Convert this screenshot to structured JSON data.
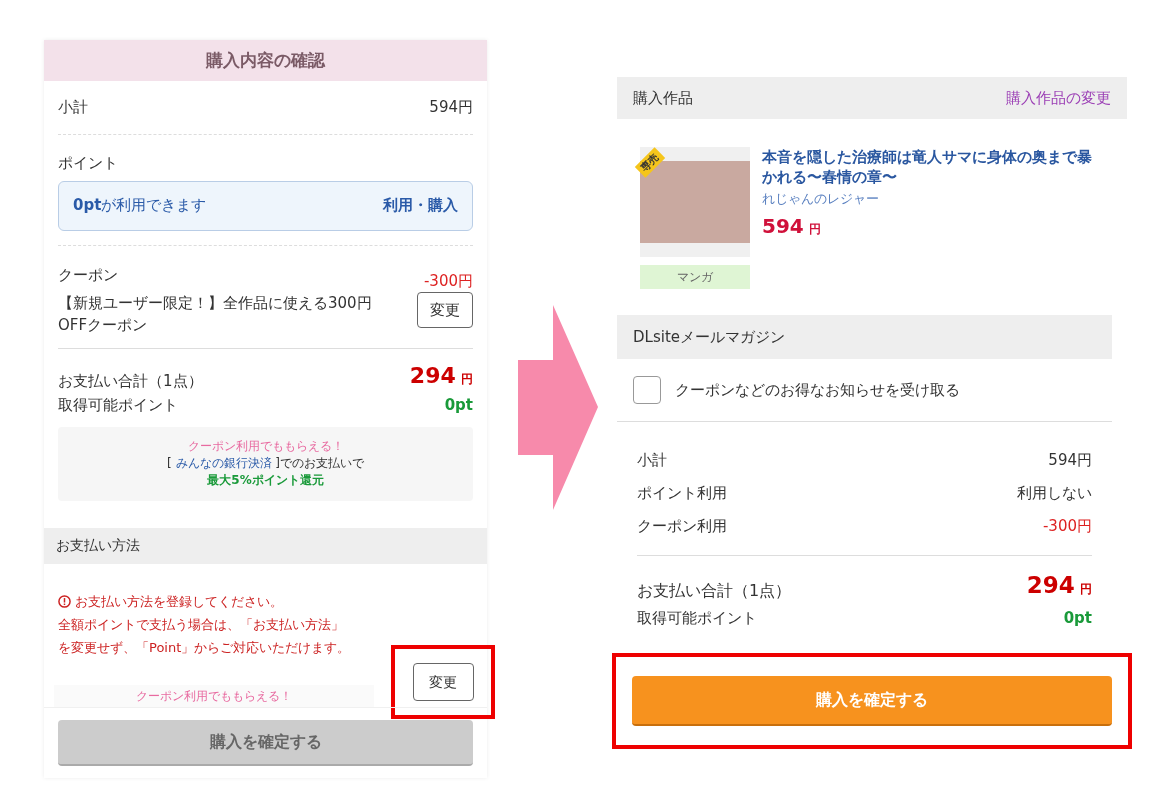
{
  "left": {
    "title": "購入内容の確認",
    "subtotal": {
      "label": "小計",
      "value": "594円"
    },
    "points": {
      "label": "ポイント",
      "amount": "0pt",
      "text": "が利用できます",
      "action": "利用・購入"
    },
    "coupon": {
      "label": "クーポン",
      "value": "-300円",
      "name": "【新規ユーザー限定！】全作品に使える300円OFFクーポン",
      "button": "変更"
    },
    "total": {
      "label": "お支払い合計（1点）",
      "amount": "294",
      "unit": "円"
    },
    "earn": {
      "label": "取得可能ポイント",
      "value": "0pt"
    },
    "promo": {
      "headline": "クーポン利用でももらえる！",
      "bracket_open": "[",
      "link": "みんなの銀行決済",
      "bracket_close": "]でのお支払いで",
      "reward": "最大5%ポイント還元"
    },
    "payment": {
      "title": "お支払い方法",
      "error_lines": [
        "お支払い方法を登録してください。",
        "全額ポイントで支払う場合は、「お支払い方法」",
        "を変更せず、「Point」からご対応いただけます。"
      ],
      "button": {
        "label": "変更",
        "highlighted": true
      }
    },
    "promo_partial": "クーポン利用でももらえる！",
    "confirm": {
      "label": "購入を確定する",
      "disabled": true
    }
  },
  "right": {
    "section": "購入作品",
    "change_link": "購入作品の変更",
    "product": {
      "badge": "専売",
      "title": "本音を隠した治療師は竜人サマに身体の奥まで暴かれる〜春情の章〜",
      "circle": "れじゃんのレジャー",
      "price": "594",
      "unit": "円",
      "category": "マンガ"
    },
    "magazine": {
      "title": "DLsiteメールマガジン",
      "option": {
        "label": "クーポンなどのお得なお知らせを受け取る",
        "checked": false
      }
    },
    "summary": [
      {
        "label": "小計",
        "value": "594円",
        "kind": "plain"
      },
      {
        "label": "ポイント利用",
        "value": "利用しない",
        "kind": "plain"
      },
      {
        "label": "クーポン利用",
        "value": "-300円",
        "kind": "discount"
      }
    ],
    "total": {
      "label": "お支払い合計（1点）",
      "amount": "294",
      "unit": "円"
    },
    "earn": {
      "label": "取得可能ポイント",
      "value": "0pt"
    },
    "confirm": {
      "label": "購入を確定する",
      "disabled": false,
      "highlighted": true
    }
  }
}
